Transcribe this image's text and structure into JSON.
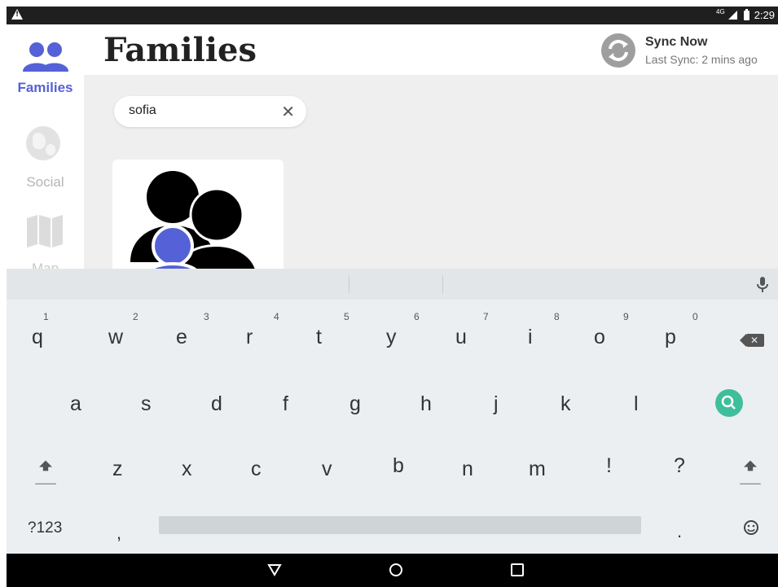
{
  "status_bar": {
    "network": "4G",
    "time": "2:29"
  },
  "sidebar": {
    "items": [
      {
        "label": "Families",
        "icon": "families-icon",
        "active": true
      },
      {
        "label": "Social",
        "icon": "globe-icon",
        "active": false
      },
      {
        "label": "Map",
        "icon": "map-icon",
        "active": false
      }
    ]
  },
  "header": {
    "title": "Families",
    "sync": {
      "title": "Sync Now",
      "subtitle": "Last Sync: 2 mins ago"
    }
  },
  "search": {
    "value": "sofia",
    "clear_icon": "close-icon"
  },
  "results": [
    {
      "icon": "family-avatar-icon"
    }
  ],
  "keyboard": {
    "row1": [
      {
        "key": "q",
        "hint": "1"
      },
      {
        "key": "w",
        "hint": "2"
      },
      {
        "key": "e",
        "hint": "3"
      },
      {
        "key": "r",
        "hint": "4"
      },
      {
        "key": "t",
        "hint": "5"
      },
      {
        "key": "y",
        "hint": "6"
      },
      {
        "key": "u",
        "hint": "7"
      },
      {
        "key": "i",
        "hint": "8"
      },
      {
        "key": "o",
        "hint": "9"
      },
      {
        "key": "p",
        "hint": "0"
      }
    ],
    "row2": [
      "a",
      "s",
      "d",
      "f",
      "g",
      "h",
      "j",
      "k",
      "l"
    ],
    "row3": [
      "z",
      "x",
      "c",
      "v",
      "b",
      "n",
      "m",
      "!",
      "?"
    ],
    "symbols_label": "?123",
    "comma": ",",
    "period": "."
  },
  "colors": {
    "accent": "#5561d6",
    "search_key": "#3ebf9b",
    "status_bar": "#1f1f1f"
  }
}
